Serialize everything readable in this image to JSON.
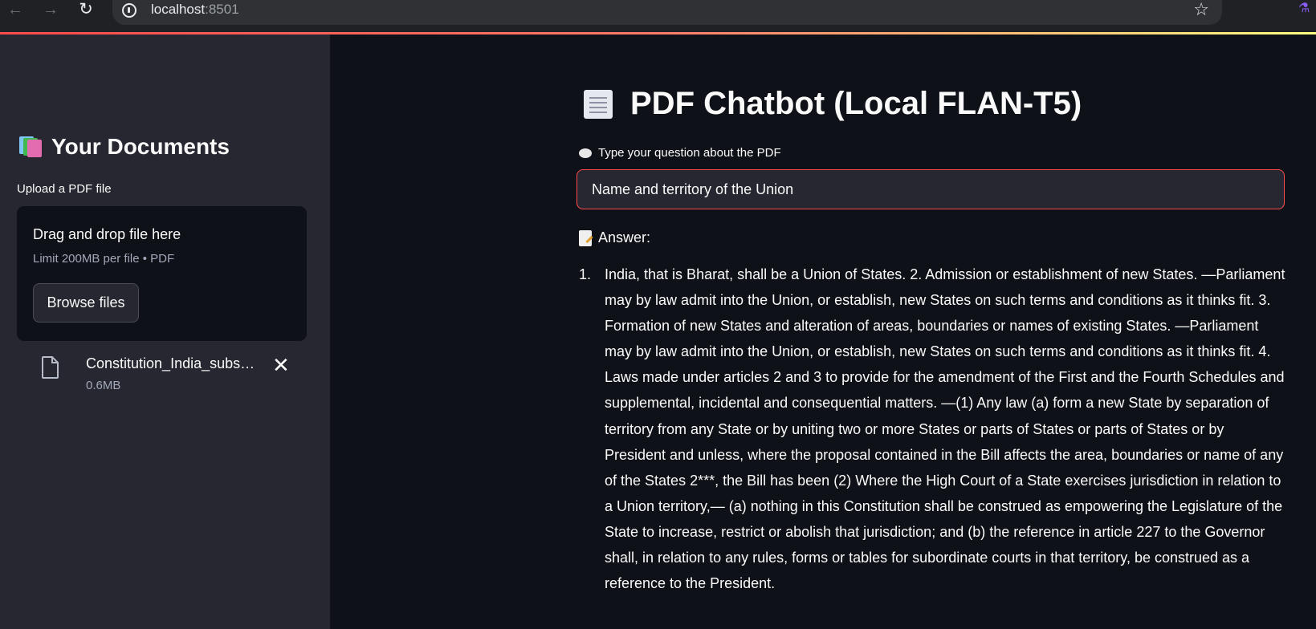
{
  "browser": {
    "url_host": "localhost",
    "url_port": ":8501"
  },
  "sidebar": {
    "title": "Your Documents",
    "title_icon": "books-icon",
    "upload_label": "Upload a PDF file",
    "dropzone": {
      "title": "Drag and drop file here",
      "subtitle": "Limit 200MB per file • PDF",
      "browse_label": "Browse files"
    },
    "file": {
      "name": "Constitution_India_subs…",
      "size": "0.6MB"
    }
  },
  "main": {
    "title": "PDF Chatbot (Local FLAN-T5)",
    "title_icon": "page-icon",
    "question_label": "Type your question about the PDF",
    "question_value": "Name and territory of the Union",
    "answer_label": "Answer:",
    "answers": [
      {
        "number": "1.",
        "text": "India, that is Bharat, shall be a Union of States. 2. Admission or establishment of new States. —Parliament may by law admit into the Union, or establish, new States on such terms and conditions as it thinks fit. 3. Formation of new States and alteration of areas, boundaries or names of existing States. —Parliament may by law admit into the Union, or establish, new States on such terms and conditions as it thinks fit. 4. Laws made under articles 2 and 3 to provide for the amendment of the First and the Fourth Schedules and supplemental, incidental and consequential matters. —(1) Any law (a) form a new State by separation of territory from any State or by uniting two or more States or parts of States or parts of States or by President and unless, where the proposal contained in the Bill affects the area, boundaries or name of any of the States 2***, the Bill has been (2) Where the High Court of a State exercises jurisdiction in relation to a Union territory,— (a) nothing in this Constitution shall be construed as empowering the Legislature of the State to increase, restrict or abolish that jurisdiction; and (b) the reference in article 227 to the Governor shall, in relation to any rules, forms or tables for subordinate courts in that territory, be construed as a reference to the President."
      }
    ]
  },
  "colors": {
    "accent": "#ff4b4b",
    "sidebar_bg": "#262730",
    "main_bg": "#0e1117"
  }
}
